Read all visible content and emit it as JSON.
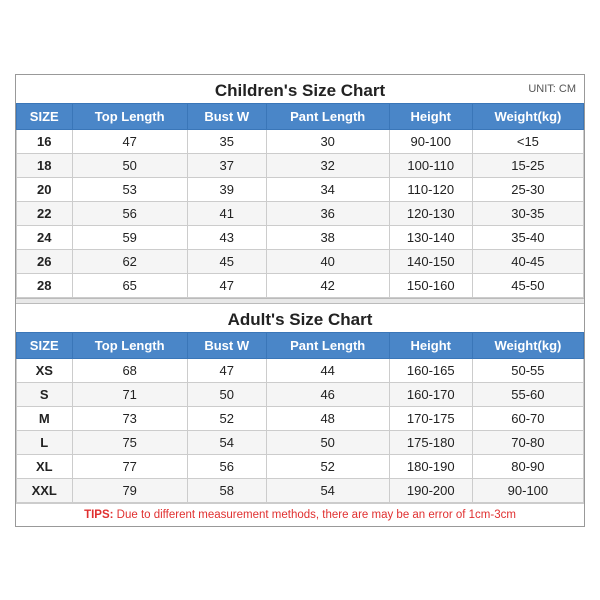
{
  "children_title": "Children's Size Chart",
  "adults_title": "Adult's Size Chart",
  "unit": "UNIT: CM",
  "children_headers": [
    "SIZE",
    "Top Length",
    "Bust W",
    "Pant Length",
    "Height",
    "Weight(kg)"
  ],
  "children_rows": [
    [
      "16",
      "47",
      "35",
      "30",
      "90-100",
      "<15"
    ],
    [
      "18",
      "50",
      "37",
      "32",
      "100-110",
      "15-25"
    ],
    [
      "20",
      "53",
      "39",
      "34",
      "110-120",
      "25-30"
    ],
    [
      "22",
      "56",
      "41",
      "36",
      "120-130",
      "30-35"
    ],
    [
      "24",
      "59",
      "43",
      "38",
      "130-140",
      "35-40"
    ],
    [
      "26",
      "62",
      "45",
      "40",
      "140-150",
      "40-45"
    ],
    [
      "28",
      "65",
      "47",
      "42",
      "150-160",
      "45-50"
    ]
  ],
  "adults_headers": [
    "SIZE",
    "Top Length",
    "Bust W",
    "Pant Length",
    "Height",
    "Weight(kg)"
  ],
  "adults_rows": [
    [
      "XS",
      "68",
      "47",
      "44",
      "160-165",
      "50-55"
    ],
    [
      "S",
      "71",
      "50",
      "46",
      "160-170",
      "55-60"
    ],
    [
      "M",
      "73",
      "52",
      "48",
      "170-175",
      "60-70"
    ],
    [
      "L",
      "75",
      "54",
      "50",
      "175-180",
      "70-80"
    ],
    [
      "XL",
      "77",
      "56",
      "52",
      "180-190",
      "80-90"
    ],
    [
      "XXL",
      "79",
      "58",
      "54",
      "190-200",
      "90-100"
    ]
  ],
  "tips_label": "TIPS:",
  "tips_text": " Due to different measurement methods, there are may be an error of 1cm-3cm"
}
